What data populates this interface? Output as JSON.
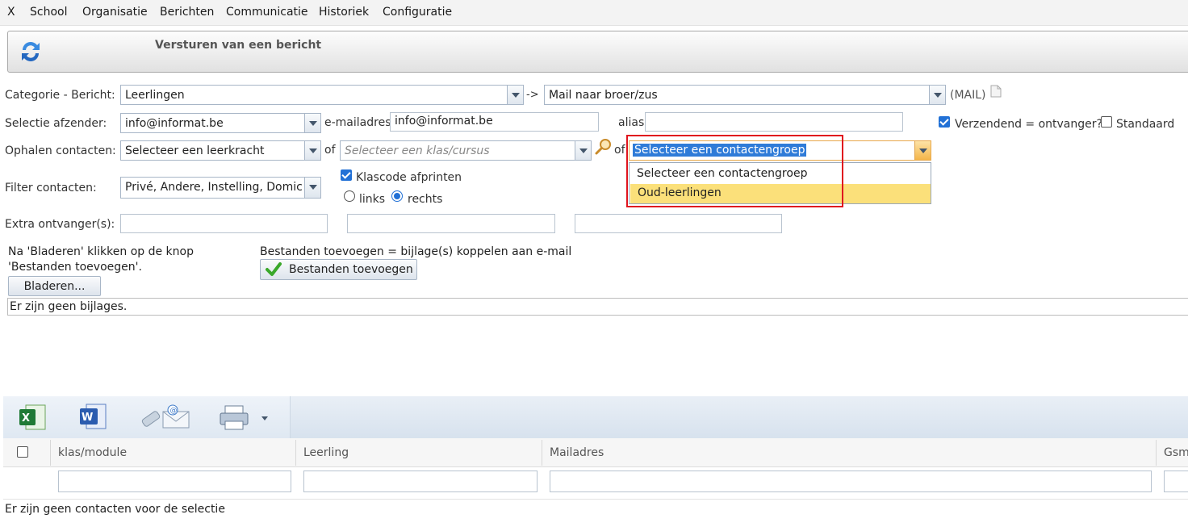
{
  "menu": [
    "X",
    "School",
    "Organisatie",
    "Berichten",
    "Communicatie",
    "Historiek",
    "Configuratie"
  ],
  "header": {
    "title": "Versturen van een bericht",
    "icon": "refresh-arrows-icon"
  },
  "form": {
    "categorie_label": "Categorie - Bericht:",
    "categorie_value": "Leerlingen",
    "arrow": "->",
    "bericht_value": "Mail naar broer/zus",
    "mail_tag": "(MAIL)",
    "afzender_label": "Selectie afzender:",
    "afzender_value": "info@informat.be",
    "emailadres_label": "e-mailadres",
    "emailadres_value": "info@informat.be",
    "alias_label": "alias",
    "alias_value": "",
    "verzendend_label": "Verzendend = ontvanger?",
    "verzendend_checked": true,
    "standaard_label": "Standaard",
    "standaard_checked": false,
    "ophalen_label": "Ophalen contacten:",
    "leerkracht_value": "Selecteer een leerkracht",
    "of1": "of",
    "klas_placeholder": "Selecteer een klas/cursus",
    "of2": "of",
    "contactgroep_value": "Selecteer een contactengroep",
    "filter_label": "Filter contacten:",
    "filter_value": "Privé, Andere, Instelling, Domicili",
    "klascode_label": "Klascode afprinten",
    "klascode_checked": true,
    "links_label": "links",
    "rechts_label": "rechts",
    "position_selected": "rechts",
    "extra_label": "Extra ontvanger(s):",
    "extra_values": [
      "",
      "",
      ""
    ]
  },
  "dropdown": {
    "options": [
      "Selecteer een contactengroep",
      "Oud-leerlingen"
    ],
    "highlighted": "Oud-leerlingen",
    "highlight_color": "#fbe07a"
  },
  "attachments": {
    "instruction": "Na 'Bladeren' klikken op de knop 'Bestanden toevoegen'.",
    "bladeren_label": "Bladeren...",
    "add_info": "Bestanden toevoegen = bijlage(s) koppelen aan e-mail",
    "add_button_label": "Bestanden toevoegen",
    "status": "Er zijn geen bijlages."
  },
  "grid": {
    "toolbar_icons": [
      "excel-icon",
      "word-icon",
      "send-mail-icon",
      "printer-icon"
    ],
    "columns": [
      "klas/module",
      "Leerling",
      "Mailadres",
      "Gsm"
    ],
    "empty_message": "Er zijn geen contacten voor de selectie"
  },
  "colors": {
    "highlight_border": "#e0141e",
    "selected_text_bg": "#2f7bd8",
    "checkbox_blue": "#2271d6"
  }
}
